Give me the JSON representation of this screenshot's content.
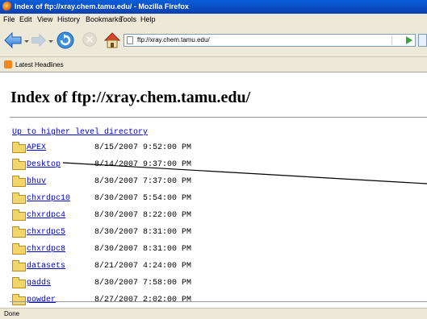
{
  "window": {
    "title": "Index of ftp://xray.chem.tamu.edu/ - Mozilla Firefox"
  },
  "menu": [
    "File",
    "Edit",
    "View",
    "History",
    "Bookmarks",
    "Tools",
    "Help"
  ],
  "navbar": {
    "url": "ftp://xray.chem.tamu.edu/"
  },
  "bookmarks": {
    "items": [
      "Latest Headlines"
    ]
  },
  "page": {
    "title": "Index of ftp://xray.chem.tamu.edu/",
    "up_link": "Up to higher level directory",
    "entries": [
      {
        "name": "APEX",
        "date": "8/15/2007 9:52:00 PM"
      },
      {
        "name": "Desktop",
        "date": "8/14/2007 9:37:00 PM"
      },
      {
        "name": "bhuv",
        "date": "8/30/2007 7:37:00 PM"
      },
      {
        "name": "chxrdpc10",
        "date": "8/30/2007 5:54:00 PM"
      },
      {
        "name": "chxrdpc4",
        "date": "8/30/2007 8:22:00 PM"
      },
      {
        "name": "chxrdpc5",
        "date": "8/30/2007 8:31:00 PM"
      },
      {
        "name": "chxrdpc8",
        "date": "8/30/2007 8:31:00 PM"
      },
      {
        "name": "datasets",
        "date": "8/21/2007 4:24:00 PM"
      },
      {
        "name": "gadds",
        "date": "8/30/2007 7:58:00 PM"
      },
      {
        "name": "powder",
        "date": "8/27/2007 2:02:00 PM"
      }
    ]
  },
  "status": {
    "text": "Done"
  }
}
